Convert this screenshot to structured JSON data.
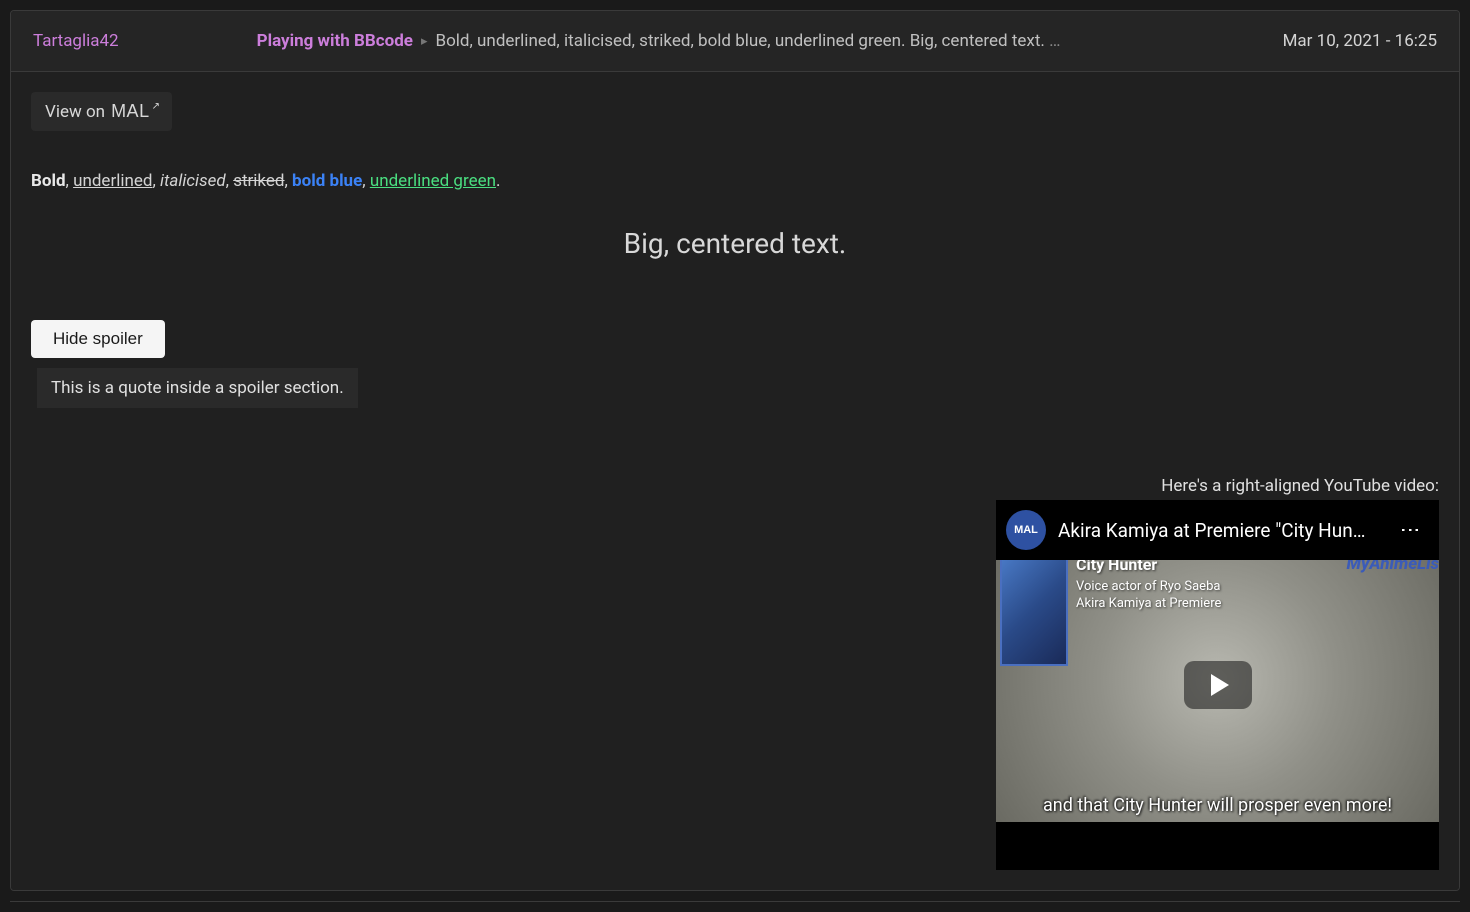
{
  "header": {
    "username": "Tartaglia42",
    "title": "Playing with BBcode",
    "preview": "Bold, underlined, italicised, striked, bold blue, underlined green. Big, centered text. ",
    "ellipsis": "…",
    "date": "Mar 10, 2021 - 16:25"
  },
  "view_on_label": "View on",
  "mal_logo_text": "MAL",
  "content": {
    "bold": "Bold",
    "underlined": "underlined",
    "italicised": "italicised",
    "striked": "striked",
    "bold_blue": "bold blue",
    "underlined_green": "underlined green",
    "big_centered": "Big, centered text."
  },
  "spoiler_button": "Hide spoiler",
  "quote": "This is a quote inside a spoiler section.",
  "video_section": {
    "caption": "Here's a right-aligned YouTube video:",
    "channel_icon": "MAL",
    "title": "Akira Kamiya at Premiere \"City Hun…",
    "show_title": "City Hunter",
    "voice_actor_line": "Voice actor of Ryo Saeba",
    "actor_name": "Akira Kamiya at Premiere",
    "watermark": "MyAnimeLis",
    "subtitle": "and that City Hunter will prosper even more!"
  }
}
